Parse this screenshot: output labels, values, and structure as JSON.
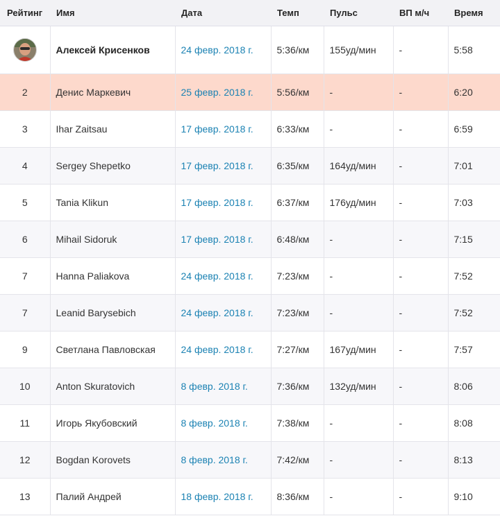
{
  "columns": {
    "rank": "Рейтинг",
    "name": "Имя",
    "date": "Дата",
    "pace": "Темп",
    "hr": "Пульс",
    "vam": "ВП м/ч",
    "time": "Время"
  },
  "rows": [
    {
      "rank": "",
      "name": "Алексей Крисенков",
      "date": "24 февр. 2018 г.",
      "pace": "5:36/км",
      "hr": "155уд/мин",
      "vam": "-",
      "time": "5:58"
    },
    {
      "rank": "2",
      "name": "Денис Маркевич",
      "date": "25 февр. 2018 г.",
      "pace": "5:56/км",
      "hr": "-",
      "vam": "-",
      "time": "6:20"
    },
    {
      "rank": "3",
      "name": "Ihar Zaitsau",
      "date": "17 февр. 2018 г.",
      "pace": "6:33/км",
      "hr": "-",
      "vam": "-",
      "time": "6:59"
    },
    {
      "rank": "4",
      "name": "Sergey Shepetko",
      "date": "17 февр. 2018 г.",
      "pace": "6:35/км",
      "hr": "164уд/мин",
      "vam": "-",
      "time": "7:01"
    },
    {
      "rank": "5",
      "name": "Tania Klikun",
      "date": "17 февр. 2018 г.",
      "pace": "6:37/км",
      "hr": "176уд/мин",
      "vam": "-",
      "time": "7:03"
    },
    {
      "rank": "6",
      "name": "Mihail Sidoruk",
      "date": "17 февр. 2018 г.",
      "pace": "6:48/км",
      "hr": "-",
      "vam": "-",
      "time": "7:15"
    },
    {
      "rank": "7",
      "name": "Hanna Paliakova",
      "date": "24 февр. 2018 г.",
      "pace": "7:23/км",
      "hr": "-",
      "vam": "-",
      "time": "7:52"
    },
    {
      "rank": "7",
      "name": "Leanid Barysebich",
      "date": "24 февр. 2018 г.",
      "pace": "7:23/км",
      "hr": "-",
      "vam": "-",
      "time": "7:52"
    },
    {
      "rank": "9",
      "name": "Светлана Павловская",
      "date": "24 февр. 2018 г.",
      "pace": "7:27/км",
      "hr": "167уд/мин",
      "vam": "-",
      "time": "7:57"
    },
    {
      "rank": "10",
      "name": "Anton Skuratovich",
      "date": "8 февр. 2018 г.",
      "pace": "7:36/км",
      "hr": "132уд/мин",
      "vam": "-",
      "time": "8:06"
    },
    {
      "rank": "11",
      "name": "Игорь Якубовский",
      "date": "8 февр. 2018 г.",
      "pace": "7:38/км",
      "hr": "-",
      "vam": "-",
      "time": "8:08"
    },
    {
      "rank": "12",
      "name": "Bogdan Korovets",
      "date": "8 февр. 2018 г.",
      "pace": "7:42/км",
      "hr": "-",
      "vam": "-",
      "time": "8:13"
    },
    {
      "rank": "13",
      "name": "Палий Андрей",
      "date": "18 февр. 2018 г.",
      "pace": "8:36/км",
      "hr": "-",
      "vam": "-",
      "time": "9:10"
    }
  ],
  "colors": {
    "header_bg": "#f2f2f5",
    "highlight_row": "#fdd9cc",
    "date_link": "#1b82b3",
    "stripe": "#f7f7fa"
  },
  "icons": {
    "first_place": "avatar-icon"
  }
}
